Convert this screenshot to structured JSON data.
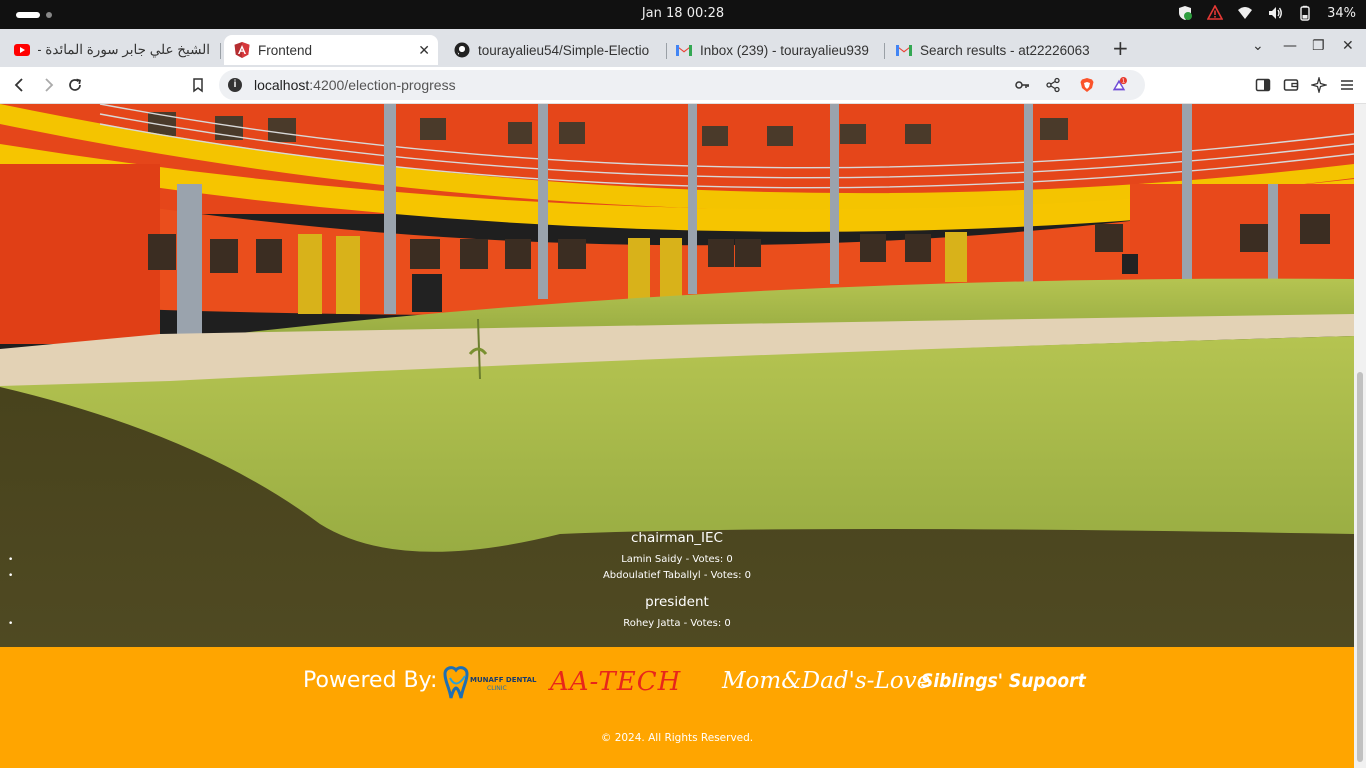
{
  "os": {
    "clock": "Jan 18  00:28",
    "battery": "34%"
  },
  "tabs": [
    {
      "title": "الشيخ علي جابر سورة المائدة - e",
      "icon": "youtube-icon",
      "active": false
    },
    {
      "title": "Frontend",
      "icon": "angular-icon",
      "active": true
    },
    {
      "title": "tourayalieu54/Simple-Electio",
      "icon": "github-icon",
      "active": false
    },
    {
      "title": "Inbox (239) - tourayalieu939",
      "icon": "gmail-icon",
      "active": false
    },
    {
      "title": "Search results - at22226063",
      "icon": "gmail-icon",
      "active": false
    }
  ],
  "address": {
    "host": "localhost",
    "path": ":4200/election-progress"
  },
  "brave_badge": "1",
  "results": {
    "positions": [
      {
        "title": "chairman_IEC",
        "candidates": [
          "Lamin Saidy - Votes: 0",
          "Abdoulatief Taballyl - Votes: 0"
        ]
      },
      {
        "title": "president",
        "candidates": [
          "Rohey Jatta - Votes: 0"
        ]
      }
    ]
  },
  "footer": {
    "powered_by": "Powered By:",
    "dental_line1": "MUNAFF DENTAL",
    "dental_line2": "CLINIC",
    "aatech": "AA-TECH",
    "mom_dad": "Mom&Dad's-Love",
    "siblings": "Siblings' Supoort",
    "copyright": "© 2024. All Rights Reserved."
  },
  "colors": {
    "footer_bg": "#ffa500",
    "building_orange": "#e8481a",
    "balcony_yellow": "#f5c400",
    "grass": "#8aa83a"
  }
}
